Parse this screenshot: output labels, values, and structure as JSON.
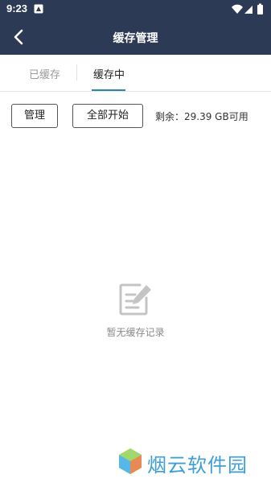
{
  "status_bar": {
    "time": "9:23"
  },
  "header": {
    "title": "缓存管理"
  },
  "tabs": [
    {
      "label": "已缓存",
      "active": false
    },
    {
      "label": "缓存中",
      "active": true
    }
  ],
  "toolbar": {
    "manage_label": "管理",
    "start_all_label": "全部开始",
    "storage_text": "剩余：29.39 GB可用"
  },
  "empty_state": {
    "text": "暂无缓存记录",
    "icon": "edit-note-icon"
  },
  "watermark": {
    "text": "烟云软件园"
  },
  "colors": {
    "header_bg": "#2d3a55",
    "active_tab_underline": "#2a86a9",
    "watermark_text": "#3e9fd6"
  }
}
